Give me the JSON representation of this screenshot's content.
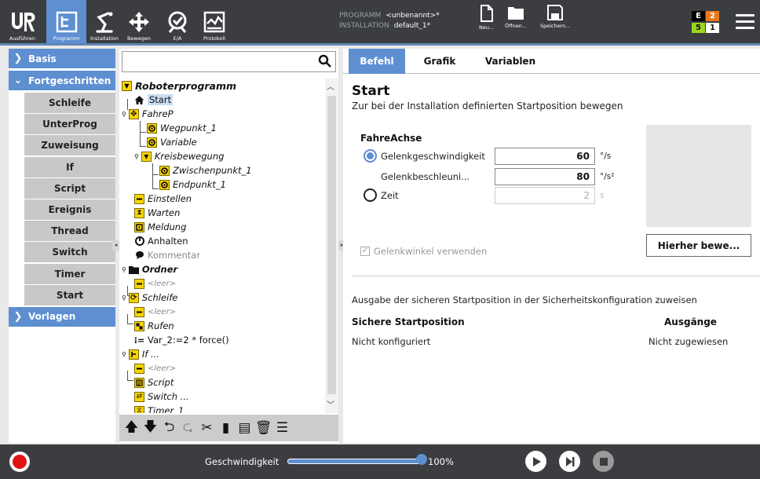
{
  "header": {
    "nav": [
      {
        "label": "Ausführen",
        "icon": "ur-logo-icon"
      },
      {
        "label": "Programm",
        "icon": "program-tree-icon",
        "active": true
      },
      {
        "label": "Installation",
        "icon": "robot-arm-icon"
      },
      {
        "label": "Bewegen",
        "icon": "move-arrows-icon"
      },
      {
        "label": "E/A",
        "icon": "io-icon"
      },
      {
        "label": "Protokoll",
        "icon": "log-icon"
      }
    ],
    "program_key": "PROGRAMM",
    "program_value": "<unbenannt>*",
    "installation_key": "INSTALLATION",
    "installation_value": "default_1*",
    "file_buttons": [
      "Neu...",
      "Öffnen...",
      "Speichern..."
    ],
    "mode": {
      "e_label": "E",
      "e_count": "2",
      "s_count": "5",
      "s2_count": "1"
    }
  },
  "sidebar": {
    "basis_label": "Basis",
    "advanced_label": "Fortgeschritten",
    "templates_label": "Vorlagen",
    "items": [
      "Schleife",
      "UnterProg",
      "Zuweisung",
      "If",
      "Script",
      "Ereignis",
      "Thread",
      "Switch",
      "Timer",
      "Start"
    ]
  },
  "tree": {
    "search_placeholder": "",
    "nodes": [
      {
        "text": "Roboterprogramm",
        "style": "bold-italic"
      },
      {
        "text": "Start",
        "style": "selected"
      },
      {
        "text": "FahreP",
        "style": "italic"
      },
      {
        "text": "Wegpunkt_1",
        "style": "italic"
      },
      {
        "text": "Variable",
        "style": "italic"
      },
      {
        "text": "Kreisbewegung",
        "style": "italic"
      },
      {
        "text": "Zwischenpunkt_1",
        "style": "italic"
      },
      {
        "text": "Endpunkt_1",
        "style": "italic"
      },
      {
        "text": "Einstellen",
        "style": "italic"
      },
      {
        "text": "Warten",
        "style": "italic"
      },
      {
        "text": "Meldung",
        "style": "italic"
      },
      {
        "text": "Anhalten",
        "style": "normal"
      },
      {
        "text": "Kommentar",
        "style": "grey"
      },
      {
        "text": "Ordner",
        "style": "bold-italic"
      },
      {
        "text": "<leer>",
        "style": "grey-italic"
      },
      {
        "text": "Schleife",
        "style": "italic"
      },
      {
        "text": "<leer>",
        "style": "grey-italic"
      },
      {
        "text": "Rufen",
        "style": "italic"
      },
      {
        "text": "Var_2:=2 * force()",
        "style": "normal"
      },
      {
        "text": "If ...",
        "style": "italic"
      },
      {
        "text": "<leer>",
        "style": "grey-italic"
      },
      {
        "text": "Script",
        "style": "italic"
      },
      {
        "text": "Switch ...",
        "style": "italic"
      },
      {
        "text": "Timer_1",
        "style": "italic"
      }
    ]
  },
  "tabs": [
    "Befehl",
    "Grafik",
    "Variablen"
  ],
  "command": {
    "title": "Start",
    "subtitle": "Zur bei der Installation definierten Startposition bewegen",
    "movej_title": "FahreAchse",
    "joint_speed_label": "Gelenkgeschwindigkeit",
    "joint_speed_value": "60",
    "joint_speed_unit": "°/s",
    "joint_accel_label": "Gelenkbeschleuni...",
    "joint_accel_value": "80",
    "joint_accel_unit": "°/s²",
    "time_label": "Zeit",
    "time_value": "2",
    "time_unit": "s",
    "move_here_label": "Hierher bewe...",
    "use_joint_angles_label": "Gelenkwinkel verwenden",
    "safe_desc": "Ausgabe der sicheren Startposition in der Sicherheitskonfiguration zuweisen",
    "safe_col1": "Sichere Startposition",
    "safe_col2": "Ausgänge",
    "safe_val1": "Nicht konfiguriert",
    "safe_val2": "Nicht zugewiesen"
  },
  "footer": {
    "speed_label": "Geschwindigkeit",
    "speed_value": "100%",
    "speed_fraction": 1.0
  },
  "colors": {
    "accent": "#5d8fd1",
    "bar": "#3b3d40",
    "record": "#e01414",
    "yellow_icon": "#f8d400"
  }
}
